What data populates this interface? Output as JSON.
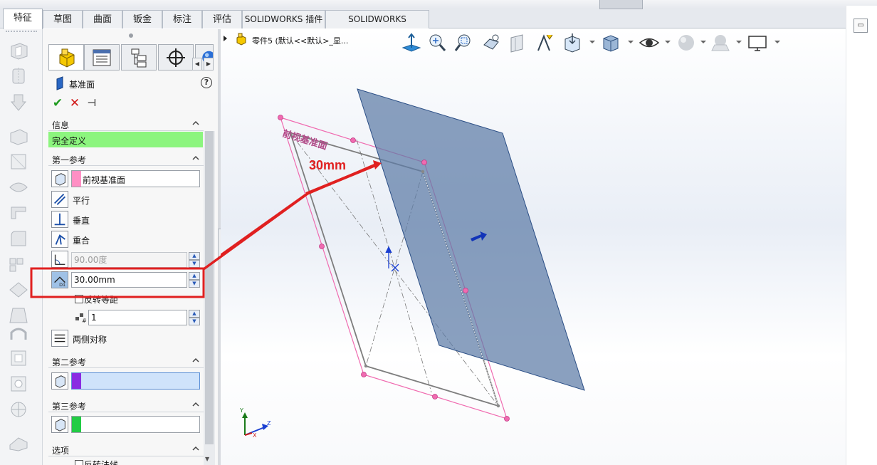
{
  "tabs": [
    {
      "label": "特征",
      "active": true
    },
    {
      "label": "草图",
      "active": false
    },
    {
      "label": "曲面",
      "active": false
    },
    {
      "label": "钣金",
      "active": false
    },
    {
      "label": "标注",
      "active": false
    },
    {
      "label": "评估",
      "active": false
    },
    {
      "label": "SOLIDWORKS 插件",
      "active": false
    },
    {
      "label": "SOLIDWORKS Inspection",
      "active": false
    }
  ],
  "property_manager": {
    "title": "基准面",
    "help_icon": "?",
    "actions": {
      "ok": "✔",
      "cancel": "✕",
      "pin": "⊣"
    },
    "sections": {
      "info": {
        "label": "信息",
        "status": "完全定义",
        "status_color": "#8cf57e"
      },
      "first_ref": {
        "label": "第一参考",
        "reference": "前视基准面",
        "swatch_color": "#ff8fc4",
        "options": [
          "平行",
          "垂直",
          "重合"
        ],
        "angle_value": "90.00度",
        "offset_value": "30.00mm",
        "flip_offset": "反转等距",
        "count_value": "1",
        "symmetric": "两侧对称"
      },
      "second_ref": {
        "label": "第二参考",
        "swatch_color": "#8a2be2"
      },
      "third_ref": {
        "label": "第三参考",
        "swatch_color": "#22cc44"
      },
      "options": {
        "label": "选项",
        "flip_normal": "反转法线"
      }
    }
  },
  "viewport": {
    "tree_node": "零件5 (默认<<默认>_显...",
    "plane_label": "前视基准面",
    "annotation": "30mm",
    "annotation_color": "#e02020",
    "triad_labels": {
      "x": "X",
      "y": "Y",
      "z": "Z"
    }
  },
  "icons": [
    "part-icon",
    "up-arrow-icon",
    "zoom-fit-icon",
    "zoom-area-icon",
    "previous-view-icon",
    "section-view-icon",
    "dynamic-annotation-icon",
    "view-orientation-icon",
    "display-style-icon",
    "hide-show-icon",
    "edit-appearance-icon",
    "apply-scene-icon",
    "view-settings-icon",
    "help-icon",
    "checkmark-icon",
    "close-icon",
    "pin-icon",
    "chevron-up-icon"
  ]
}
